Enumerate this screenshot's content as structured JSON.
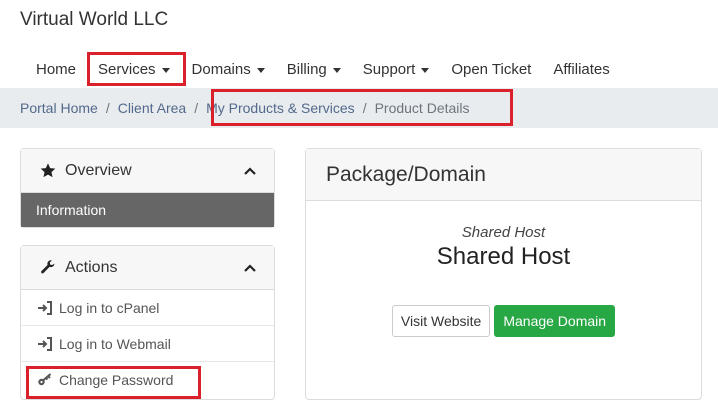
{
  "brand": {
    "name": "Virtual World LLC"
  },
  "nav": {
    "items": [
      {
        "label": "Home",
        "has_caret": false
      },
      {
        "label": "Services",
        "has_caret": true
      },
      {
        "label": "Domains",
        "has_caret": true
      },
      {
        "label": "Billing",
        "has_caret": true
      },
      {
        "label": "Support",
        "has_caret": true
      },
      {
        "label": "Open Ticket",
        "has_caret": false
      },
      {
        "label": "Affiliates",
        "has_caret": false
      }
    ]
  },
  "breadcrumb": {
    "items": [
      "Portal Home",
      "Client Area",
      "My Products & Services",
      "Product Details"
    ],
    "separator": "/"
  },
  "sidebar": {
    "overview": {
      "title": "Overview",
      "icon": "star-icon",
      "items": [
        "Information"
      ]
    },
    "actions": {
      "title": "Actions",
      "icon": "wrench-icon",
      "items": [
        {
          "label": "Log in to cPanel",
          "icon": "sign-in-icon"
        },
        {
          "label": "Log in to Webmail",
          "icon": "sign-in-icon"
        },
        {
          "label": "Change Password",
          "icon": "key-icon"
        }
      ]
    }
  },
  "main": {
    "card_title": "Package/Domain",
    "package_group": "Shared Host",
    "package_name": "Shared Host",
    "buttons": {
      "visit": "Visit Website",
      "manage": "Manage Domain"
    }
  },
  "colors": {
    "highlight": "#d9202b",
    "success": "#28a745",
    "active_item": "#666666",
    "breadcrumb_bg": "#e9ecef",
    "link": "#52698b"
  }
}
